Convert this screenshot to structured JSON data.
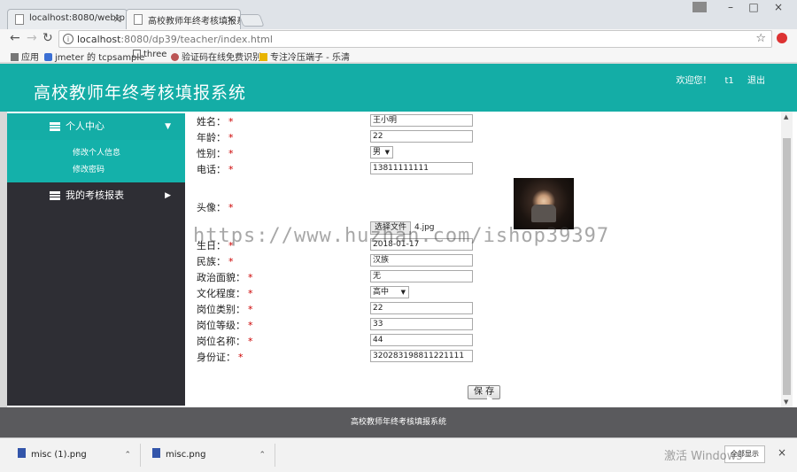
{
  "browser": {
    "tabs": [
      {
        "label": "localhost:8080/webtp",
        "active": false
      },
      {
        "label": "高校教师年终考核填报系",
        "active": true
      }
    ],
    "url_host": "localhost",
    "url_path": ":8080/dp39/teacher/index.html",
    "bookmarks": [
      {
        "label": "应用",
        "icon": "apps-grid-icon"
      },
      {
        "label": "jmeter 的 tcpsample",
        "icon": "shield-icon"
      },
      {
        "label": "three",
        "icon": "page-icon"
      },
      {
        "label": "验证码在线免费识别-",
        "icon": "globe-icon"
      },
      {
        "label": "专注冷压端子 - 乐清",
        "icon": "thumb-icon"
      }
    ]
  },
  "header": {
    "title": "高校教师年终考核填报系统",
    "welcome": "欢迎您！",
    "username": "t1",
    "logout": "退出"
  },
  "sidebar": {
    "sections": [
      {
        "label": "个人中心",
        "expanded": true,
        "arrow": "▼",
        "items": [
          {
            "label": "修改个人信息"
          },
          {
            "label": "修改密码"
          }
        ]
      },
      {
        "label": "我的考核报表",
        "expanded": false,
        "arrow": "▶",
        "items": []
      }
    ]
  },
  "form": {
    "required_mark": "*",
    "fields": {
      "name": {
        "label": "姓名：",
        "value": "王小明"
      },
      "age": {
        "label": "年龄：",
        "value": "22"
      },
      "gender": {
        "label": "性别：",
        "value": "男"
      },
      "phone": {
        "label": "电话：",
        "value": "13811111111"
      },
      "avatar": {
        "label": "头像：",
        "button": "选择文件",
        "filename": "4.jpg"
      },
      "birthday": {
        "label": "生日：",
        "value": "2018-01-17"
      },
      "ethnicity": {
        "label": "民族：",
        "value": "汉族"
      },
      "politics": {
        "label": "政治面貌：",
        "value": "无"
      },
      "education": {
        "label": "文化程度：",
        "value": "高中"
      },
      "post_type": {
        "label": "岗位类别：",
        "value": "22"
      },
      "post_level": {
        "label": "岗位等级：",
        "value": "33"
      },
      "post_name": {
        "label": "岗位名称：",
        "value": "44"
      },
      "id_card": {
        "label": "身份证：",
        "value": "320283198811221111"
      }
    },
    "save_label": "保 存"
  },
  "footer": {
    "text": "高校教师年终考核填报系统"
  },
  "watermark": "https://www.huzhan.com/ishop39397",
  "downloads": {
    "items": [
      {
        "label": "misc (1).png"
      },
      {
        "label": "misc.png"
      }
    ],
    "show_all": "全部显示"
  },
  "os_overlay": "激活 Windows",
  "colors": {
    "header": "#14ada6",
    "sidebar": "#2e2e34",
    "footer": "#5a5a5d",
    "required": "#cc0000"
  }
}
